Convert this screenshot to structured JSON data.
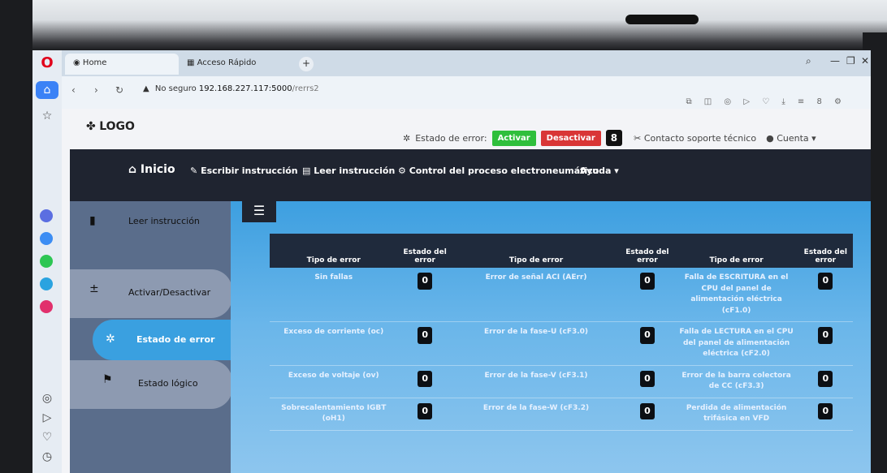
{
  "browser": {
    "tabs": [
      {
        "label": "Home",
        "active": true
      },
      {
        "label": "Acceso Rápido",
        "active": false
      }
    ],
    "new_tab": "+",
    "url_warning": "No seguro",
    "url_domain": "192.168.227.117:5000",
    "url_path": "/rerrs2"
  },
  "header": {
    "logo_text": "LOGO",
    "error_state_label": "Estado de error:",
    "activate_label": "Activar",
    "deactivate_label": "Desactivar",
    "error_count": "8",
    "support_label": "Contacto soporte técnico",
    "account_label": "Cuenta"
  },
  "mainnav": {
    "home": "Inicio",
    "write": "Escribir instrucción",
    "read": "Leer instrucción",
    "control": "Control del proceso electroneumático",
    "help": "Ayuda"
  },
  "sidebar": {
    "items": [
      {
        "label": "Leer instrucción",
        "icon": "file-icon"
      },
      {
        "label": "Activar/Desactivar",
        "icon": "plus-minus-icon"
      },
      {
        "label": "Estado de error",
        "icon": "bug-icon"
      },
      {
        "label": "Estado lógico",
        "icon": "flag-icon"
      }
    ]
  },
  "table": {
    "headers": [
      "Tipo de error",
      "Estado del error",
      "Tipo de error",
      "Estado del error",
      "Tipo de error",
      "Estado del error"
    ],
    "rows": [
      [
        {
          "name": "Sin fallas",
          "state": "0"
        },
        {
          "name": "Error de señal ACI (AErr)",
          "state": "0"
        },
        {
          "name": "Falla de ESCRITURA en el CPU del panel de alimentación eléctrica (cF1.0)",
          "state": "0"
        }
      ],
      [
        {
          "name": "Exceso de corriente (oc)",
          "state": "0"
        },
        {
          "name": "Error de la fase-U (cF3.0)",
          "state": "0"
        },
        {
          "name": "Falla de LECTURA en el CPU del panel de alimentación eléctrica (cF2.0)",
          "state": "0"
        }
      ],
      [
        {
          "name": "Exceso de voltaje (ov)",
          "state": "0"
        },
        {
          "name": "Error de la fase-V (cF3.1)",
          "state": "0"
        },
        {
          "name": "Error de la barra colectora de CC (cF3.3)",
          "state": "0"
        }
      ],
      [
        {
          "name": "Sobrecalentamiento IGBT (oH1)",
          "state": "0"
        },
        {
          "name": "Error de la fase-W (cF3.2)",
          "state": "0"
        },
        {
          "name": "Perdida de alimentación trifásica en VFD",
          "state": "0"
        }
      ]
    ]
  }
}
